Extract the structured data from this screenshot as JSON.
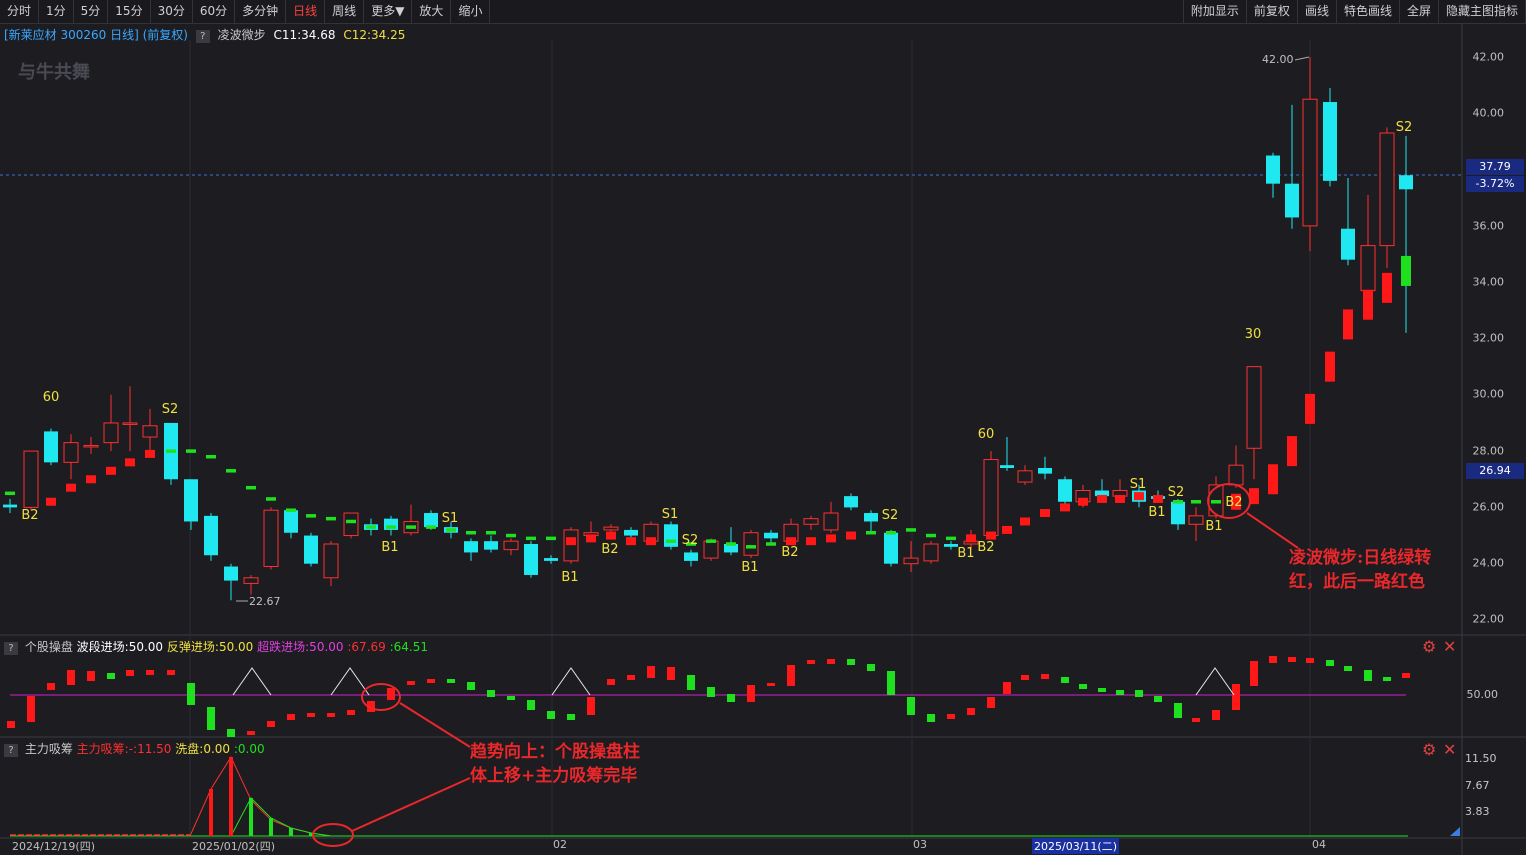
{
  "toolbar": {
    "left": [
      "分时",
      "1分",
      "5分",
      "15分",
      "30分",
      "60分",
      "多分钟",
      "日线",
      "周线",
      "更多▼",
      "放大",
      "缩小"
    ],
    "active": "日线",
    "right": [
      "附加显示",
      "前复权",
      "画线",
      "特色画线",
      "全屏",
      "隐藏主图指标"
    ]
  },
  "info": {
    "stock": "[新莱应材 300260 日线] (前复权)",
    "indicator": "凌波微步",
    "c1": "C11:34.68",
    "c2": "C12:34.25"
  },
  "logo": "与牛共舞",
  "price_axis": {
    "ticks": [
      "42.00",
      "40.00",
      "38.00",
      "36.00",
      "34.00",
      "32.00",
      "30.00",
      "28.00",
      "26.00",
      "24.00",
      "22.00"
    ],
    "current_price": "37.79",
    "change_pct": "-3.72%",
    "highlight_price": "26.94",
    "max_label": "42.00",
    "min_label": "22.67"
  },
  "panel2": {
    "title": "个股操盘",
    "wave": "波段进场:50.00",
    "rebound": "反弹进场:50.00",
    "oversold": "超跌进场:50.00",
    "v1": ":67.69",
    "v2": ":64.51",
    "axis": "50.00"
  },
  "panel3": {
    "title": "主力吸筹",
    "absorb": "主力吸筹:-:11.50",
    "wash": "洗盘:0.00",
    "v": ":0.00",
    "axis": [
      "11.50",
      "7.67",
      "3.83"
    ]
  },
  "dates": {
    "d1": "2024/12/19(四)",
    "d2": "2025/01/02(四)",
    "m2": "02",
    "m3": "03",
    "d3": "2025/03/11(二)",
    "m4": "04"
  },
  "signals": {
    "b1": "B1",
    "b2": "B2",
    "s1": "S1",
    "s2": "S2",
    "n60": "60",
    "n30": "30"
  },
  "annotations": {
    "a1_line1": "凌波微步:日线绿转",
    "a1_line2": "红，此后一路红色",
    "a2_line1": "趋势向上：个股操盘柱",
    "a2_line2": "体上移+主力吸筹完毕"
  },
  "colors": {
    "up": "#ff3030",
    "down": "#20e8f0",
    "green": "#1fe01f",
    "red_bar": "#ff1818",
    "yellow": "#f0e040"
  }
}
